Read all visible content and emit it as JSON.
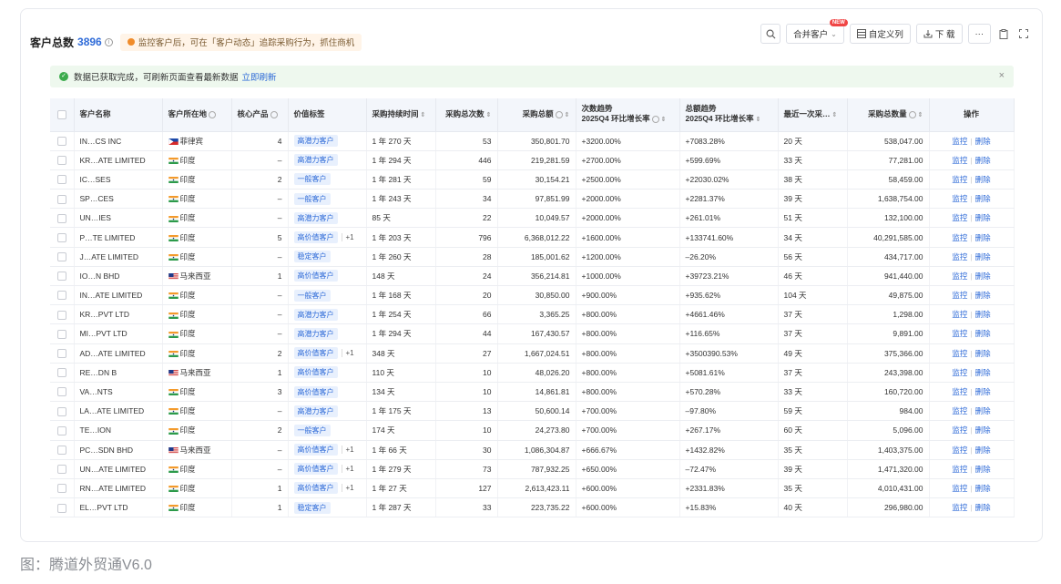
{
  "header": {
    "title": "客户总数",
    "count": "3896",
    "tip": "监控客户后，可在「客户动态」追踪采购行为，抓住商机"
  },
  "toolbar": {
    "merge_label": "合并客户",
    "new_badge": "NEW",
    "custom_cols_label": "自定义列",
    "download_label": "下 载",
    "more_label": "···"
  },
  "notice": {
    "text": "数据已获取完成，可刷新页面查看最新数据",
    "link": "立即刷新",
    "close": "×"
  },
  "columns": {
    "name": "客户名称",
    "country": "客户所在地",
    "product": "核心产品",
    "value_tag": "价值标签",
    "duration": "采购持续时间",
    "times": "采购总次数",
    "amount": "采购总额",
    "trend_count_title": "次数趋势",
    "trend_count_sub": "2025Q4 环比增长率",
    "trend_amount_title": "总额趋势",
    "trend_amount_sub": "2025Q4 环比增长率",
    "last": "最近一次采…",
    "qty": "采购总数量",
    "ops": "操作"
  },
  "ops": {
    "monitor": "监控",
    "delete": "删除"
  },
  "rows": [
    {
      "name": "IN…CS INC",
      "country": "菲律宾",
      "flag": "ph",
      "product": "4",
      "tag": "高潜力客户",
      "extra": "",
      "duration": "1 年 270 天",
      "times": "53",
      "amount": "350,801.70",
      "tc": "+3200.00%",
      "ta": "+7083.28%",
      "ta_dir": "up",
      "last": "20 天",
      "qty": "538,047.00"
    },
    {
      "name": "KR…ATE LIMITED",
      "country": "印度",
      "flag": "in",
      "product": "–",
      "tag": "高潜力客户",
      "extra": "",
      "duration": "1 年 294 天",
      "times": "446",
      "amount": "219,281.59",
      "tc": "+2700.00%",
      "ta": "+599.69%",
      "ta_dir": "up",
      "last": "33 天",
      "qty": "77,281.00"
    },
    {
      "name": "IC…SES",
      "country": "印度",
      "flag": "in",
      "product": "2",
      "tag": "一般客户",
      "extra": "",
      "duration": "1 年 281 天",
      "times": "59",
      "amount": "30,154.21",
      "tc": "+2500.00%",
      "ta": "+22030.02%",
      "ta_dir": "up",
      "last": "38 天",
      "qty": "58,459.00"
    },
    {
      "name": "SP…CES",
      "country": "印度",
      "flag": "in",
      "product": "–",
      "tag": "一般客户",
      "extra": "",
      "duration": "1 年 243 天",
      "times": "34",
      "amount": "97,851.99",
      "tc": "+2000.00%",
      "ta": "+2281.37%",
      "ta_dir": "up",
      "last": "39 天",
      "qty": "1,638,754.00"
    },
    {
      "name": "UN…IES",
      "country": "印度",
      "flag": "in",
      "product": "–",
      "tag": "高潜力客户",
      "extra": "",
      "duration": "85 天",
      "times": "22",
      "amount": "10,049.57",
      "tc": "+2000.00%",
      "ta": "+261.01%",
      "ta_dir": "up",
      "last": "51 天",
      "qty": "132,100.00"
    },
    {
      "name": "P…TE LIMITED",
      "country": "印度",
      "flag": "in",
      "product": "5",
      "tag": "高价值客户",
      "extra": "+1",
      "duration": "1 年 203 天",
      "times": "796",
      "amount": "6,368,012.22",
      "tc": "+1600.00%",
      "ta": "+133741.60%",
      "ta_dir": "up",
      "last": "34 天",
      "qty": "40,291,585.00"
    },
    {
      "name": "J…ATE LIMITED",
      "country": "印度",
      "flag": "in",
      "product": "–",
      "tag": "稳定客户",
      "extra": "",
      "duration": "1 年 260 天",
      "times": "28",
      "amount": "185,001.62",
      "tc": "+1200.00%",
      "ta": "–26.20%",
      "ta_dir": "down",
      "last": "56 天",
      "qty": "434,717.00"
    },
    {
      "name": "IO…N BHD",
      "country": "马来西亚",
      "flag": "my",
      "product": "1",
      "tag": "高价值客户",
      "extra": "",
      "duration": "148 天",
      "times": "24",
      "amount": "356,214.81",
      "tc": "+1000.00%",
      "ta": "+39723.21%",
      "ta_dir": "up",
      "last": "46 天",
      "qty": "941,440.00"
    },
    {
      "name": "IN…ATE LIMITED",
      "country": "印度",
      "flag": "in",
      "product": "–",
      "tag": "一般客户",
      "extra": "",
      "duration": "1 年 168 天",
      "times": "20",
      "amount": "30,850.00",
      "tc": "+900.00%",
      "ta": "+935.62%",
      "ta_dir": "up",
      "last": "104 天",
      "qty": "49,875.00"
    },
    {
      "name": "KR…PVT LTD",
      "country": "印度",
      "flag": "in",
      "product": "–",
      "tag": "高潜力客户",
      "extra": "",
      "duration": "1 年 254 天",
      "times": "66",
      "amount": "3,365.25",
      "tc": "+800.00%",
      "ta": "+4661.46%",
      "ta_dir": "up",
      "last": "37 天",
      "qty": "1,298.00"
    },
    {
      "name": "MI…PVT LTD",
      "country": "印度",
      "flag": "in",
      "product": "–",
      "tag": "高潜力客户",
      "extra": "",
      "duration": "1 年 294 天",
      "times": "44",
      "amount": "167,430.57",
      "tc": "+800.00%",
      "ta": "+116.65%",
      "ta_dir": "up",
      "last": "37 天",
      "qty": "9,891.00"
    },
    {
      "name": "AD…ATE LIMITED",
      "country": "印度",
      "flag": "in",
      "product": "2",
      "tag": "高价值客户",
      "extra": "+1",
      "duration": "348 天",
      "times": "27",
      "amount": "1,667,024.51",
      "tc": "+800.00%",
      "ta": "+3500390.53%",
      "ta_dir": "up",
      "last": "49 天",
      "qty": "375,366.00"
    },
    {
      "name": "RE…DN B",
      "country": "马来西亚",
      "flag": "my",
      "product": "1",
      "tag": "高价值客户",
      "extra": "",
      "duration": "110 天",
      "times": "10",
      "amount": "48,026.20",
      "tc": "+800.00%",
      "ta": "+5081.61%",
      "ta_dir": "up",
      "last": "37 天",
      "qty": "243,398.00"
    },
    {
      "name": "VA…NTS",
      "country": "印度",
      "flag": "in",
      "product": "3",
      "tag": "高价值客户",
      "extra": "",
      "duration": "134 天",
      "times": "10",
      "amount": "14,861.81",
      "tc": "+800.00%",
      "ta": "+570.28%",
      "ta_dir": "up",
      "last": "33 天",
      "qty": "160,720.00"
    },
    {
      "name": "LA…ATE LIMITED",
      "country": "印度",
      "flag": "in",
      "product": "–",
      "tag": "高潜力客户",
      "extra": "",
      "duration": "1 年 175 天",
      "times": "13",
      "amount": "50,600.14",
      "tc": "+700.00%",
      "ta": "–97.80%",
      "ta_dir": "down",
      "last": "59 天",
      "qty": "984.00"
    },
    {
      "name": "TE…ION",
      "country": "印度",
      "flag": "in",
      "product": "2",
      "tag": "一般客户",
      "extra": "",
      "duration": "174 天",
      "times": "10",
      "amount": "24,273.80",
      "tc": "+700.00%",
      "ta": "+267.17%",
      "ta_dir": "up",
      "last": "60 天",
      "qty": "5,096.00"
    },
    {
      "name": "PC…SDN BHD",
      "country": "马来西亚",
      "flag": "my",
      "product": "–",
      "tag": "高价值客户",
      "extra": "+1",
      "duration": "1 年 66 天",
      "times": "30",
      "amount": "1,086,304.87",
      "tc": "+666.67%",
      "ta": "+1432.82%",
      "ta_dir": "up",
      "last": "35 天",
      "qty": "1,403,375.00"
    },
    {
      "name": "UN…ATE LIMITED",
      "country": "印度",
      "flag": "in",
      "product": "–",
      "tag": "高价值客户",
      "extra": "+1",
      "duration": "1 年 279 天",
      "times": "73",
      "amount": "787,932.25",
      "tc": "+650.00%",
      "ta": "–72.47%",
      "ta_dir": "down",
      "last": "39 天",
      "qty": "1,471,320.00"
    },
    {
      "name": "RN…ATE LIMITED",
      "country": "印度",
      "flag": "in",
      "product": "1",
      "tag": "高价值客户",
      "extra": "+1",
      "duration": "1 年 27 天",
      "times": "127",
      "amount": "2,613,423.11",
      "tc": "+600.00%",
      "ta": "+2331.83%",
      "ta_dir": "up",
      "last": "35 天",
      "qty": "4,010,431.00"
    },
    {
      "name": "EL…PVT LTD",
      "country": "印度",
      "flag": "in",
      "product": "1",
      "tag": "稳定客户",
      "extra": "",
      "duration": "1 年 287 天",
      "times": "33",
      "amount": "223,735.22",
      "tc": "+600.00%",
      "ta": "+15.83%",
      "ta_dir": "up",
      "last": "40 天",
      "qty": "296,980.00"
    }
  ],
  "caption": "图：腾道外贸通V6.0"
}
